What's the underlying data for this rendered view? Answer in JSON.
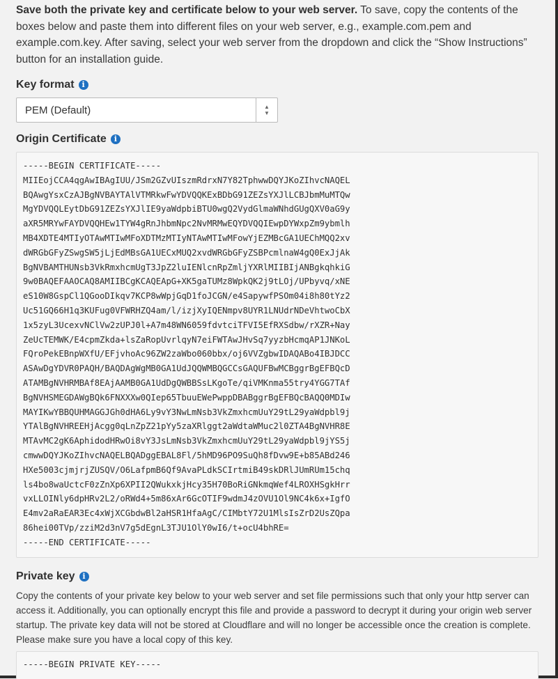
{
  "intro": {
    "bold": "Save both the private key and certificate below to your web server.",
    "text": " To save, copy the contents of the boxes below and paste them into different files on your web server, e.g., example.com.pem and example.com.key. After saving, select your web server from the dropdown and click the “Show Instructions” button for an installation guide."
  },
  "key_format": {
    "label": "Key format",
    "selected": "PEM (Default)"
  },
  "origin_certificate": {
    "label": "Origin Certificate",
    "lines": [
      "-----BEGIN CERTIFICATE-----",
      "MIIEojCCA4qgAwIBAgIUU/JSm2GZvUIszmRdrxN7Y82TphwwDQYJKoZIhvcNAQEL",
      "BQAwgYsxCzAJBgNVBAYTAlVTMRkwFwYDVQQKExBDbG91ZEZsYXJlLCBJbmMuMTQw",
      "MgYDVQQLEytDbG91ZEZsYXJlIE9yaWdpbiBTU0wgQ2VydGlmaWNhdGUgQXV0aG9y",
      "aXR5MRYwFAYDVQQHEw1TYW4gRnJhbmNpc2NvMRMwEQYDVQQIEwpDYWxpZm9ybmlh",
      "MB4XDTE4MTIyOTAwMTIwMFoXDTMzMTIyNTAwMTIwMFowYjEZMBcGA1UEChMQQ2xv",
      "dWRGbGFyZSwgSW5jLjEdMBsGA1UECxMUQ2xvdWRGbGFyZSBPcmlnaW4gQ0ExJjAk",
      "BgNVBAMTHUNsb3VkRmxhcmUgT3JpZ2luIENlcnRpZmljYXRlMIIBIjANBgkqhkiG",
      "9w0BAQEFAAOCAQ8AMIIBCgKCAQEApG+XK5gaTUMz8WpkQK2j9tLOj/UPbyvq/xNE",
      "eS10W8GspCl1QGooDIkqv7KCP8wWpjGqD1foJCGN/e4SapywfPSOm04i8h80tYz2",
      "Uc51GQ66H1q3KUFug0VFWRHZQ4am/l/izjXyIQENmpv8UYR1LNUdrNDeVhtwoCbX",
      "1x5zyL3UcexvNClVw2zUPJ0l+A7m48WN6059fdvtciTFVI5EfRXSdbw/rXZR+Nay",
      "ZeUcTEMWK/E4cpmZkda+lsZaRopUvrlqyN7eiFWTAwJHvSq7yyzbHcmqAP1JNKoL",
      "FQroPekEBnpWXfU/EFjvhoAc96ZW2zaWbo060bbx/oj6VVZgbwIDAQABo4IBJDCC",
      "ASAwDgYDVR0PAQH/BAQDAgWgMB0GA1UdJQQWMBQGCCsGAQUFBwMCBggrBgEFBQcD",
      "ATAMBgNVHRMBAf8EAjAAMB0GA1UdDgQWBBSsLKgoTe/qiVMKnma55try4YGG7TAf",
      "BgNVHSMEGDAWgBQk6FNXXXw0QIep65TbuuEWePwppDBABggrBgEFBQcBAQQ0MDIw",
      "MAYIKwYBBQUHMAGGJGh0dHA6Ly9vY3NwLmNsb3VkZmxhcmUuY29tL29yaWdpbl9j",
      "YTAlBgNVHREEHjAcgg0qLnZpZ21pYy5zaXRlggt2aWdtaWMuc2l0ZTA4BgNVHR8E",
      "MTAvMC2gK6AphidodHRwOi8vY3JsLmNsb3VkZmxhcmUuY29tL29yaWdpbl9jYS5j",
      "cmwwDQYJKoZIhvcNAQELBQADggEBAL8Fl/5hMD96PO9SuQh8fDvw9E+b85ABd246",
      "HXe5003cjmjrjZUSQV/O6LafpmB6Qf9AvaPLdkSCIrtmiB49skDRlJUmRUm15chq",
      "ls4bo8waUctcF0zZnXp6XPII2QWukxkjHcy35H70BoRiGNkmqWef4LROXHSgkHrr",
      "vxLLOINly6dpHRv2L2/oRWd4+5m86xAr6GcOTIF9wdmJ4zOVU1Ol9NC4k6x+IgfO",
      "E4mv2aRaEAR3Ec4xWjXCGbdwBl2aHSR1HfaAgC/CIMbtY72U1MlsIsZrD2UsZQpa",
      "86hei00TVp/zziM2d3nV7g5dEgnL3TJU1OlY0wI6/t+ocU4bhRE=",
      "-----END CERTIFICATE-----"
    ]
  },
  "private_key": {
    "label": "Private key",
    "description": "Copy the contents of your private key below to your web server and set file permissions such that only your http server can access it. Additionally, you can optionally encrypt this file and provide a password to decrypt it during your origin web server startup. The private key data will not be stored at Cloudflare and will no longer be accessible once the creation is complete. Please make sure you have a local copy of this key.",
    "first_line": "-----BEGIN PRIVATE KEY-----"
  },
  "icons": {
    "info": "info-circle-icon",
    "select_arrows": "select-updown-icon"
  },
  "colors": {
    "info_blue": "#1f70c1",
    "page_bg": "#f2f2f2",
    "code_bg": "#f7f7f7"
  }
}
